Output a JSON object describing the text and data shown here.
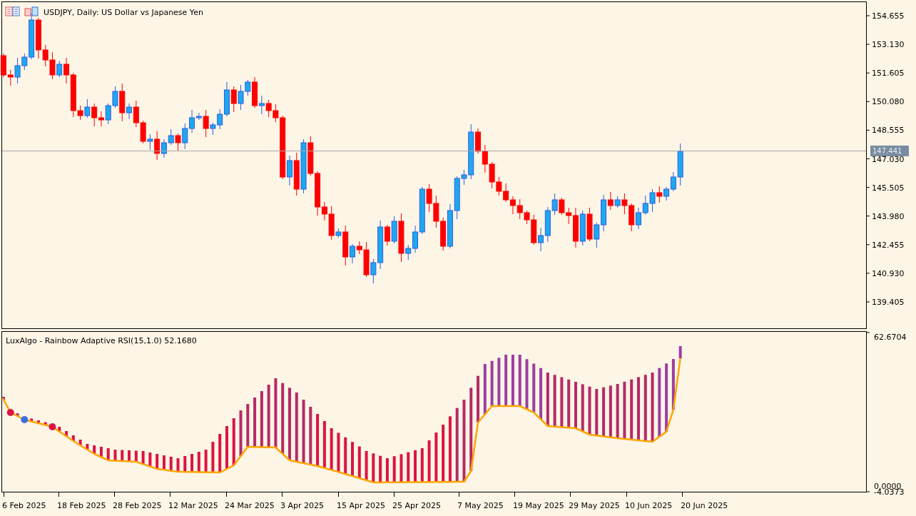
{
  "chart_title": "USDJPY, Daily:  US Dollar vs Japanese Yen",
  "price_axis": [
    "154.655",
    "153.130",
    "151.605",
    "150.080",
    "148.555",
    "147.030",
    "145.505",
    "143.980",
    "142.455",
    "140.930",
    "139.405"
  ],
  "current_price": "147.441",
  "indicator_title": "LuxAlgo - Rainbow Adaptive RSI(15,1.0) 52.1680",
  "indicator_axis": [
    "62.6704",
    "0.0000",
    "-4.0373"
  ],
  "date_axis": [
    "6 Feb 2025",
    "18 Feb 2025",
    "28 Feb 2025",
    "12 Mar 2025",
    "24 Mar 2025",
    "3 Apr 2025",
    "15 Apr 2025",
    "25 Apr 2025",
    "7 May 2025",
    "19 May 2025",
    "29 May 2025",
    "10 Jun 2025",
    "20 Jun 2025"
  ]
}
